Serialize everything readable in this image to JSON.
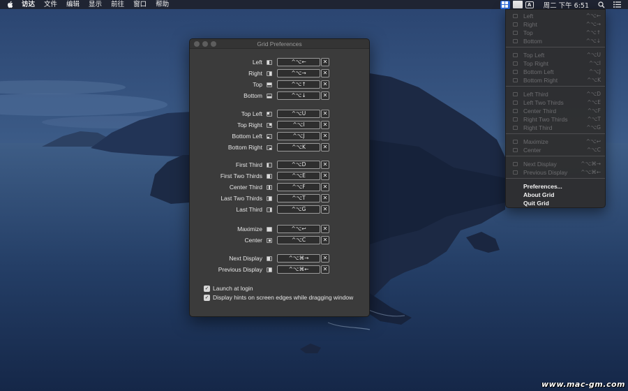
{
  "menubar": {
    "items": [
      "访达",
      "文件",
      "编辑",
      "显示",
      "前往",
      "窗口",
      "帮助"
    ],
    "status_a": "A",
    "clock": "周二 下午 6:51"
  },
  "prefs": {
    "title": "Grid Preferences",
    "rows": [
      {
        "label": "Left",
        "shortcut": "^⌥←",
        "icon": "left-half-icon"
      },
      {
        "label": "Right",
        "shortcut": "^⌥→",
        "icon": "right-half-icon"
      },
      {
        "label": "Top",
        "shortcut": "^⌥↑",
        "icon": "top-half-icon"
      },
      {
        "label": "Bottom",
        "shortcut": "^⌥↓",
        "icon": "bottom-half-icon"
      },
      {
        "label": "Top Left",
        "shortcut": "^⌥U",
        "icon": "top-left-icon"
      },
      {
        "label": "Top Right",
        "shortcut": "^⌥I",
        "icon": "top-right-icon"
      },
      {
        "label": "Bottom Left",
        "shortcut": "^⌥J",
        "icon": "bottom-left-icon"
      },
      {
        "label": "Bottom Right",
        "shortcut": "^⌥K",
        "icon": "bottom-right-icon"
      },
      {
        "label": "First Third",
        "shortcut": "^⌥D",
        "icon": "first-third-icon"
      },
      {
        "label": "First Two Thirds",
        "shortcut": "^⌥E",
        "icon": "first-two-thirds-icon"
      },
      {
        "label": "Center Third",
        "shortcut": "^⌥F",
        "icon": "center-third-icon"
      },
      {
        "label": "Last Two Thirds",
        "shortcut": "^⌥T",
        "icon": "last-two-thirds-icon"
      },
      {
        "label": "Last Third",
        "shortcut": "^⌥G",
        "icon": "last-third-icon"
      },
      {
        "label": "Maximize",
        "shortcut": "^⌥↩",
        "icon": "maximize-icon"
      },
      {
        "label": "Center",
        "shortcut": "^⌥C",
        "icon": "center-icon"
      },
      {
        "label": "Next Display",
        "shortcut": "^⌥⌘→",
        "icon": "next-display-icon"
      },
      {
        "label": "Previous Display",
        "shortcut": "^⌥⌘←",
        "icon": "previous-display-icon"
      }
    ],
    "clear_label": "✕",
    "launch_at_login": "Launch at login",
    "display_hints": "Display hints on screen edges while dragging window",
    "check_mark": "✓"
  },
  "dropdown": {
    "items": [
      {
        "label": "Left",
        "shortcut": "^⌥←"
      },
      {
        "label": "Right",
        "shortcut": "^⌥→"
      },
      {
        "label": "Top",
        "shortcut": "^⌥↑"
      },
      {
        "label": "Bottom",
        "shortcut": "^⌥↓"
      },
      {
        "label": "Top Left",
        "shortcut": "^⌥U"
      },
      {
        "label": "Top Right",
        "shortcut": "^⌥I"
      },
      {
        "label": "Bottom Left",
        "shortcut": "^⌥J"
      },
      {
        "label": "Bottom Right",
        "shortcut": "^⌥K"
      },
      {
        "label": "Left Third",
        "shortcut": "^⌥D"
      },
      {
        "label": "Left Two Thirds",
        "shortcut": "^⌥E"
      },
      {
        "label": "Center Third",
        "shortcut": "^⌥F"
      },
      {
        "label": "Right Two Thirds",
        "shortcut": "^⌥T"
      },
      {
        "label": "Right Third",
        "shortcut": "^⌥G"
      },
      {
        "label": "Maximize",
        "shortcut": "^⌥↩"
      },
      {
        "label": "Center",
        "shortcut": "^⌥C"
      },
      {
        "label": "Next Display",
        "shortcut": "^⌥⌘→"
      },
      {
        "label": "Previous Display",
        "shortcut": "^⌥⌘←"
      },
      {
        "label": "Preferences...",
        "shortcut": ""
      },
      {
        "label": "About Grid",
        "shortcut": ""
      },
      {
        "label": "Quit Grid",
        "shortcut": ""
      }
    ]
  },
  "watermark": "www.mac-gm.com"
}
